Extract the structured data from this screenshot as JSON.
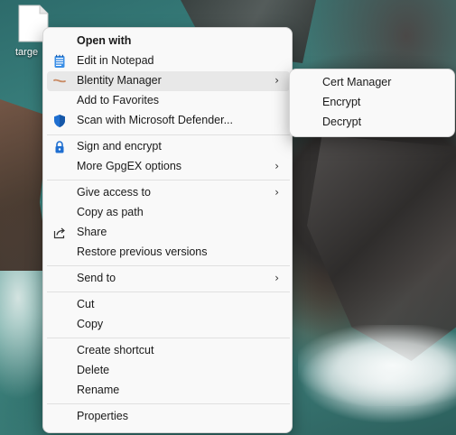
{
  "desktop": {
    "file_label": "targe",
    "file_icon": "document-icon"
  },
  "menu": {
    "items": [
      {
        "label": "Open with",
        "icon": "",
        "submenu": false,
        "bold": true
      },
      {
        "label": "Edit in Notepad",
        "icon": "notepad-icon",
        "submenu": false
      },
      {
        "label": "Blentity Manager",
        "icon": "blentity-icon",
        "submenu": true,
        "highlighted": true
      },
      {
        "label": "Add to Favorites",
        "icon": "",
        "submenu": false
      },
      {
        "label": "Scan with Microsoft Defender...",
        "icon": "defender-shield-icon",
        "submenu": false
      },
      {
        "label": "Sign and encrypt",
        "icon": "lock-icon",
        "submenu": false
      },
      {
        "label": "More GpgEX options",
        "icon": "",
        "submenu": true
      },
      {
        "label": "Give access to",
        "icon": "",
        "submenu": true
      },
      {
        "label": "Copy as path",
        "icon": "",
        "submenu": false
      },
      {
        "label": "Share",
        "icon": "share-icon",
        "submenu": false
      },
      {
        "label": "Restore previous versions",
        "icon": "",
        "submenu": false
      },
      {
        "label": "Send to",
        "icon": "",
        "submenu": true
      },
      {
        "label": "Cut",
        "icon": "",
        "submenu": false
      },
      {
        "label": "Copy",
        "icon": "",
        "submenu": false
      },
      {
        "label": "Create shortcut",
        "icon": "",
        "submenu": false
      },
      {
        "label": "Delete",
        "icon": "",
        "submenu": false
      },
      {
        "label": "Rename",
        "icon": "",
        "submenu": false
      },
      {
        "label": "Properties",
        "icon": "",
        "submenu": false
      }
    ],
    "chevron": "›"
  },
  "submenu": {
    "items": [
      {
        "label": "Cert Manager"
      },
      {
        "label": "Encrypt"
      },
      {
        "label": "Decrypt"
      }
    ]
  },
  "colors": {
    "menu_bg": "#f9f9f9",
    "hover_bg": "#e8e8e8",
    "defender_blue": "#1f6fd1",
    "notepad_blue": "#2b78d4"
  }
}
